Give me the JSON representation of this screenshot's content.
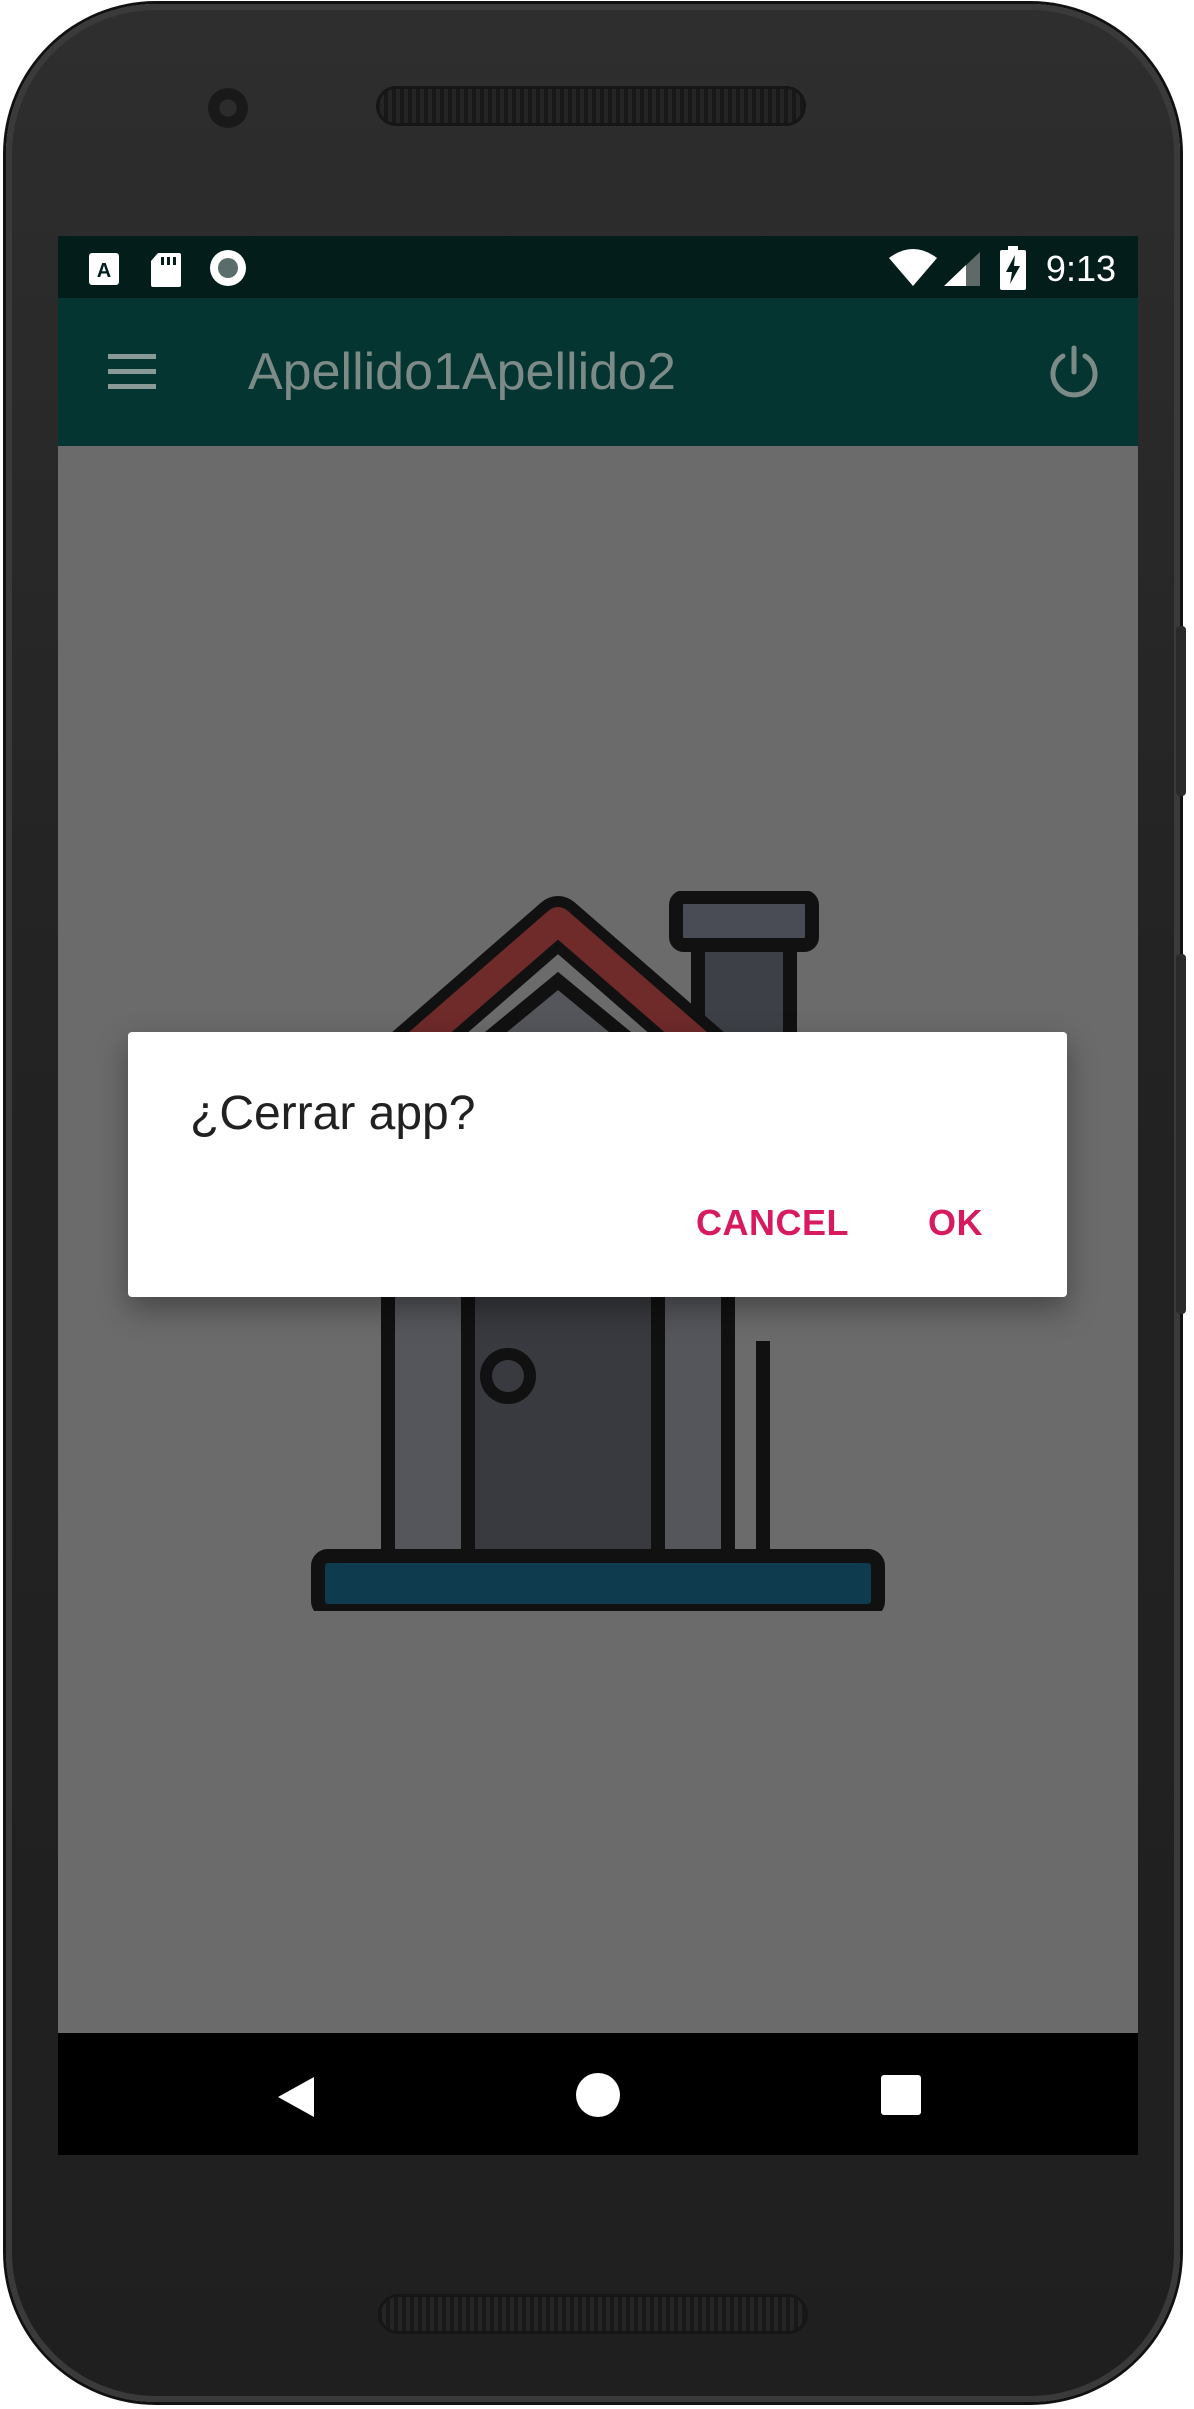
{
  "status_bar": {
    "time": "9:13",
    "left_icons": [
      "accessibility-a-icon",
      "sd-card-icon",
      "record-icon"
    ],
    "right_icons": [
      "wifi-icon",
      "cell-signal-icon",
      "battery-charging-icon"
    ]
  },
  "toolbar": {
    "title": "Apellido1Apellido2",
    "left_icon": "hamburger-menu-icon",
    "right_icon": "power-icon",
    "color": "#043530"
  },
  "content": {
    "illustration": "house-icon"
  },
  "dialog": {
    "title": "¿Cerrar app?",
    "cancel_label": "CANCEL",
    "ok_label": "OK",
    "accent_color": "#d81b60"
  },
  "nav_bar": {
    "icons": [
      "back-icon",
      "home-icon",
      "recents-icon"
    ]
  }
}
